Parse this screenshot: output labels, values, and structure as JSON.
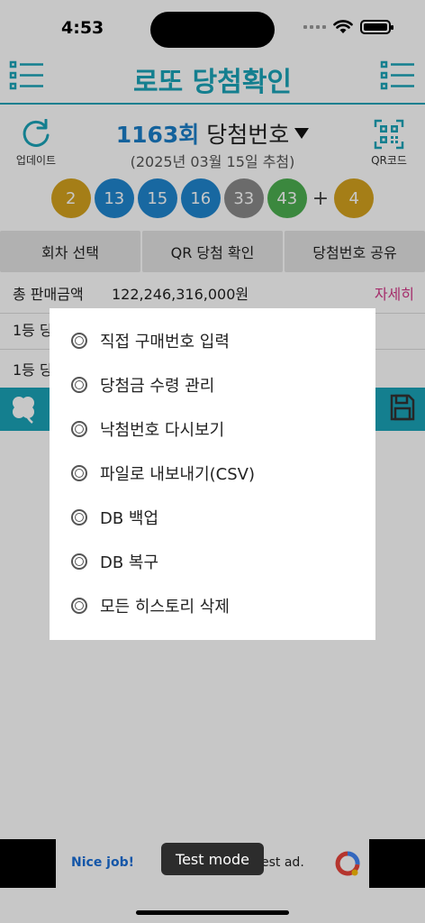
{
  "status": {
    "time": "4:53"
  },
  "header": {
    "title": "로또 당첨확인"
  },
  "draw": {
    "update_label": "업데이트",
    "qr_label": "QR코드",
    "round": "1163회",
    "title_suffix": "당첨번호",
    "date": "(2025년 03월 15일 추첨)",
    "numbers": [
      {
        "n": "2",
        "color": "#d4a21e"
      },
      {
        "n": "13",
        "color": "#1f86cf"
      },
      {
        "n": "15",
        "color": "#1f86cf"
      },
      {
        "n": "16",
        "color": "#1f86cf"
      },
      {
        "n": "33",
        "color": "#8a8a8a"
      },
      {
        "n": "43",
        "color": "#4caf50"
      }
    ],
    "plus": "+",
    "bonus": {
      "n": "4",
      "color": "#d4a21e"
    }
  },
  "tabs": [
    {
      "label": "회차 선택"
    },
    {
      "label": "QR 당첨 확인"
    },
    {
      "label": "당첨번호 공유"
    }
  ],
  "info": {
    "total_label": "총 판매금액",
    "total_value": "122,246,316,000원",
    "detail": "자세히",
    "row2_label": "1등 당",
    "row3_label": "1등 당"
  },
  "popup": {
    "items": [
      {
        "label": "직접 구매번호 입력"
      },
      {
        "label": "당첨금 수령 관리"
      },
      {
        "label": "낙첨번호 다시보기"
      },
      {
        "label": "파일로 내보내기(CSV)"
      },
      {
        "label": "DB 백업"
      },
      {
        "label": "DB 복구"
      },
      {
        "label": "모든 히스토리 삭제"
      }
    ]
  },
  "ad": {
    "nice": "Nice job!",
    "text": "est ad.",
    "toast": "Test mode"
  },
  "colors": {
    "accent": "#1aa3b8",
    "round": "#1a7ec8",
    "detail": "#d43a8a"
  }
}
